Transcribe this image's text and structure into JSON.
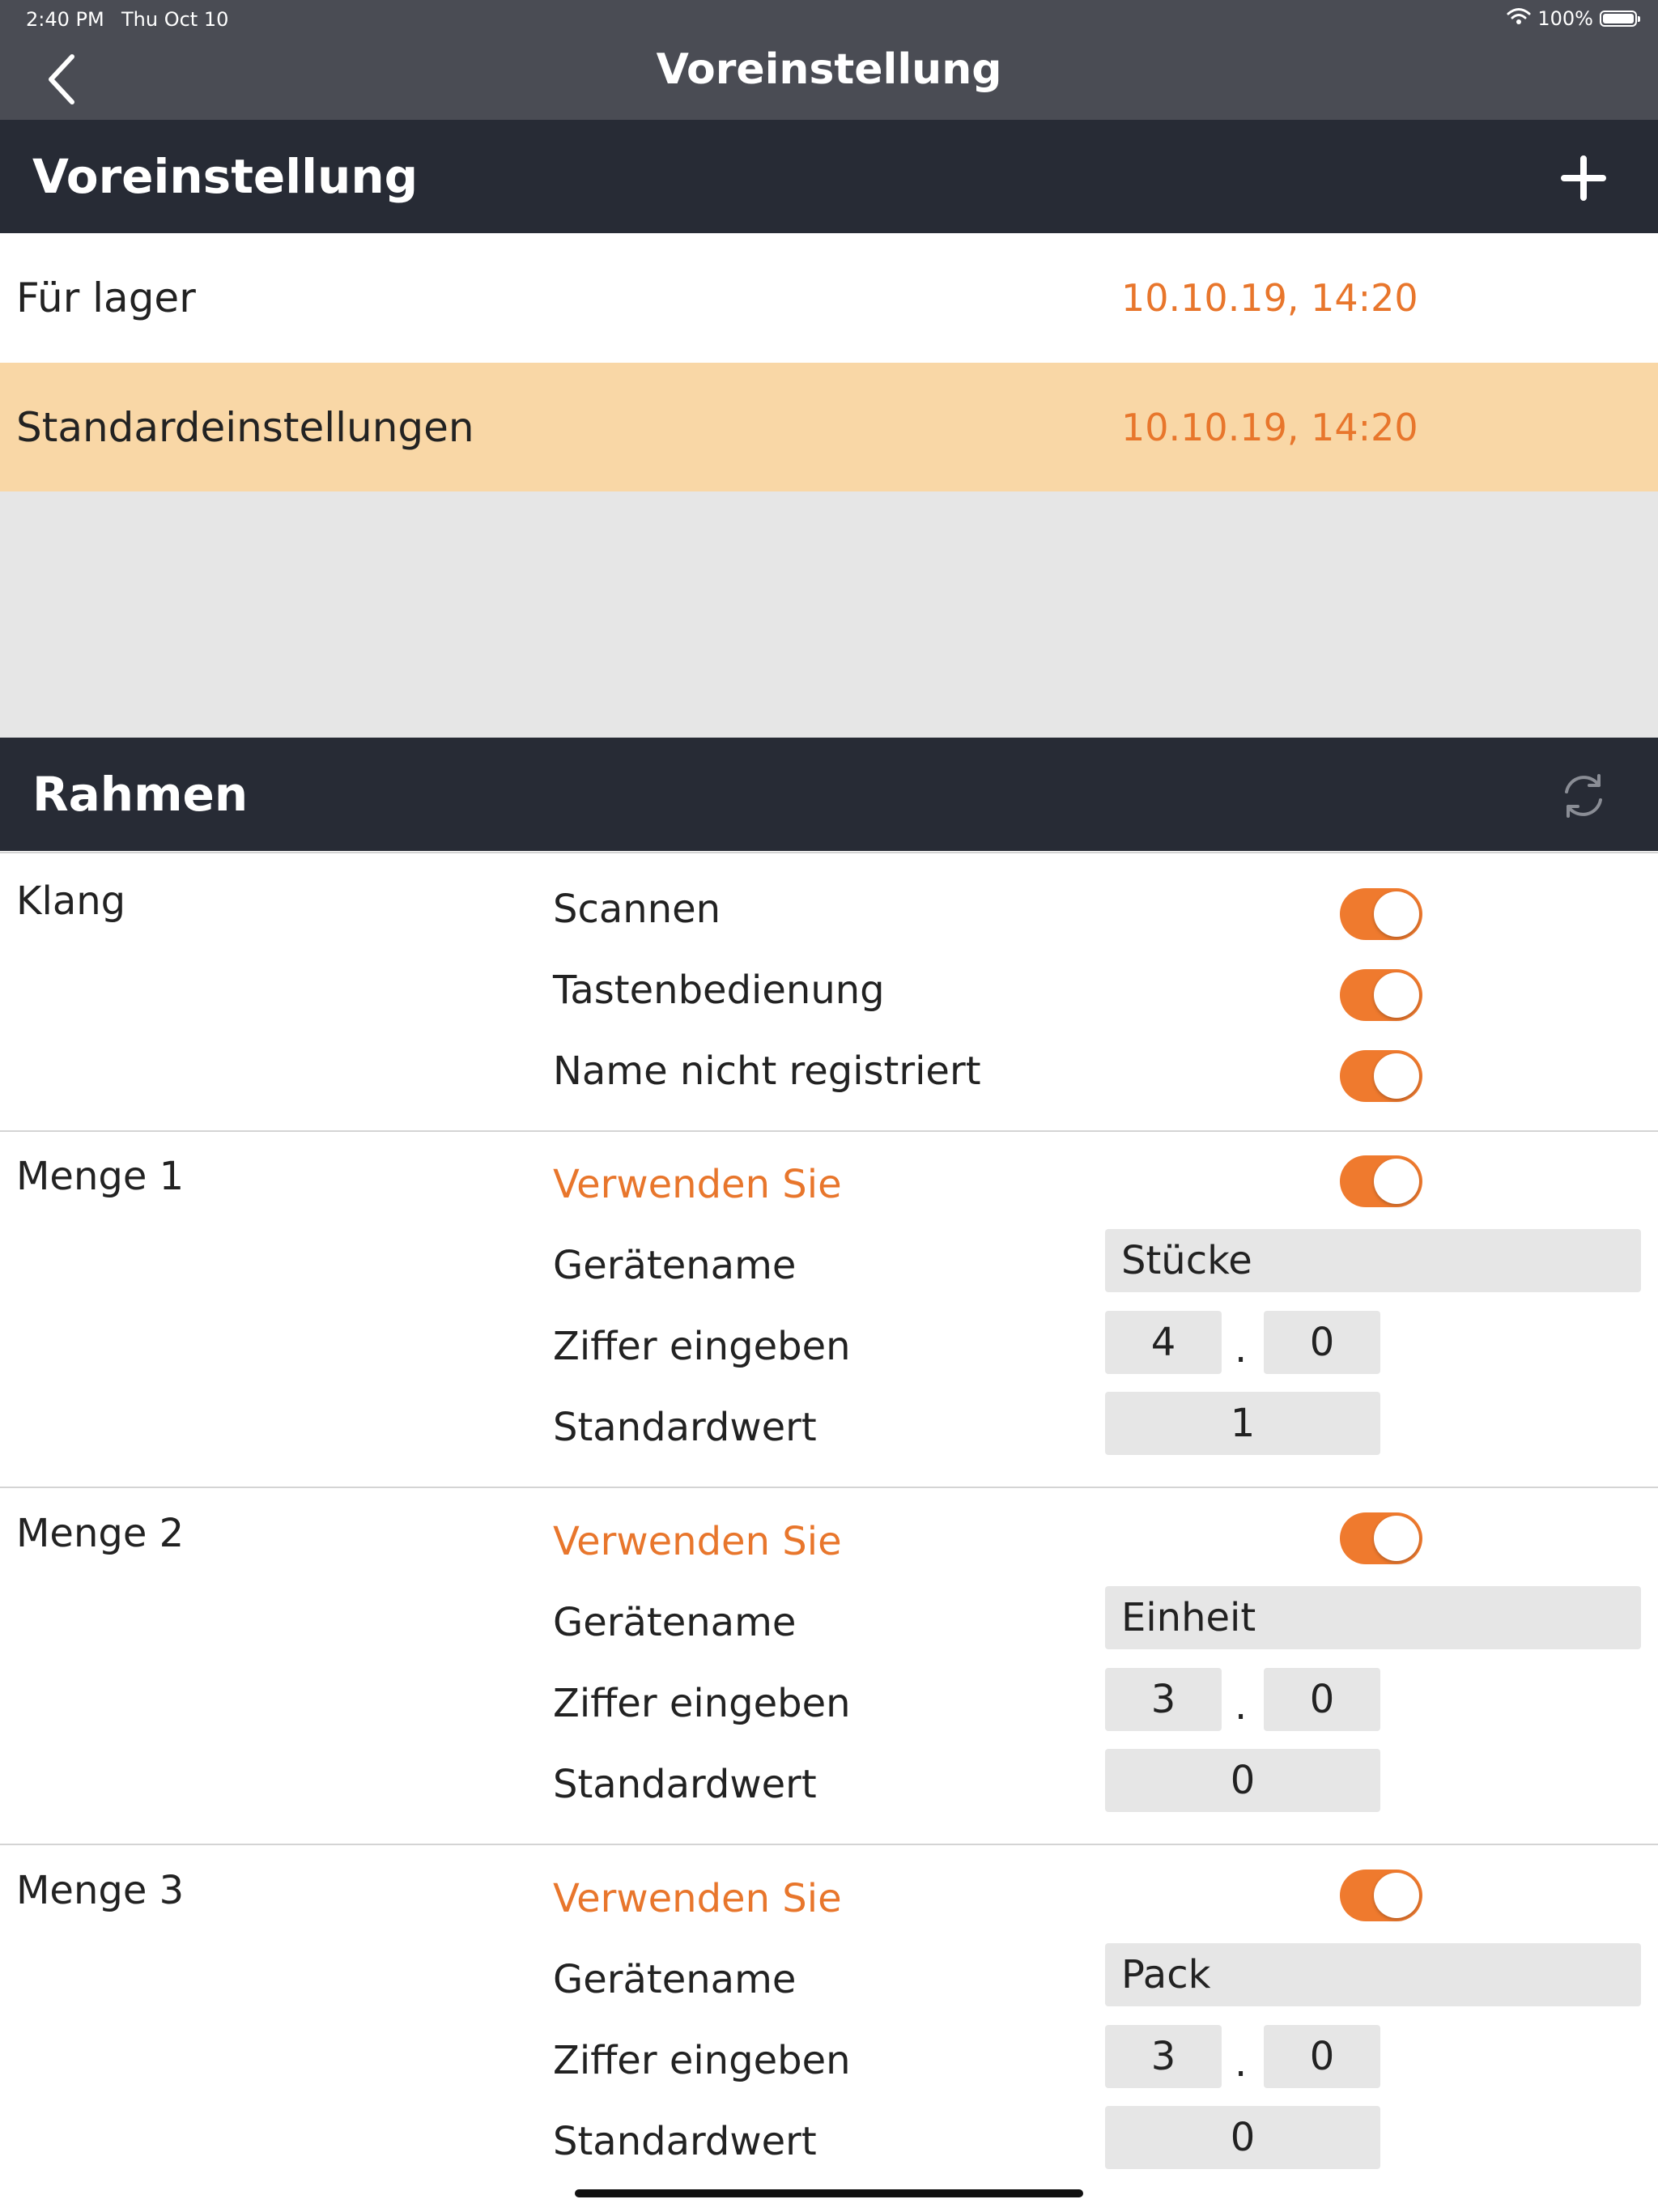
{
  "status_bar": {
    "time": "2:40 PM",
    "date": "Thu Oct 10",
    "battery": "100%",
    "icons": [
      "wifi-icon",
      "battery-icon"
    ]
  },
  "nav": {
    "title": "Voreinstellung",
    "back_icon": "chevron-left-icon"
  },
  "presets_section": {
    "title": "Voreinstellung",
    "add_icon": "plus-icon",
    "items": [
      {
        "name": "Für lager",
        "date": "10.10.19, 14:20",
        "selected": false
      },
      {
        "name": "Standardeinstellungen",
        "date": "10.10.19, 14:20",
        "selected": true
      }
    ]
  },
  "frame_section": {
    "title": "Rahmen",
    "refresh_icon": "refresh-icon",
    "klang": {
      "label": "Klang",
      "settings": [
        {
          "label": "Scannen",
          "on": true
        },
        {
          "label": "Tastenbedienung",
          "on": true
        },
        {
          "label": "Name nicht registriert",
          "on": true
        }
      ]
    },
    "mengen": [
      {
        "label": "Menge 1",
        "use_label": "Verwenden Sie",
        "use_on": true,
        "device_label": "Gerätename",
        "device_value": "Stücke",
        "digits_label": "Ziffer eingeben",
        "digit_int": "4",
        "digit_sep": ".",
        "digit_frac": "0",
        "default_label": "Standardwert",
        "default_value": "1"
      },
      {
        "label": "Menge 2",
        "use_label": "Verwenden Sie",
        "use_on": true,
        "device_label": "Gerätename",
        "device_value": "Einheit",
        "digits_label": "Ziffer eingeben",
        "digit_int": "3",
        "digit_sep": ".",
        "digit_frac": "0",
        "default_label": "Standardwert",
        "default_value": "0"
      },
      {
        "label": "Menge 3",
        "use_label": "Verwenden Sie",
        "use_on": true,
        "device_label": "Gerätename",
        "device_value": "Pack",
        "digits_label": "Ziffer eingeben",
        "digit_int": "3",
        "digit_sep": ".",
        "digit_frac": "0",
        "default_label": "Standardwert",
        "default_value": "0"
      }
    ]
  },
  "colors": {
    "accent": "#ef7a2e",
    "header_dark": "#272b35",
    "nav_bg": "#4a4c54",
    "selected_row": "#f9d7a6",
    "field_bg": "#e6e6e6"
  }
}
